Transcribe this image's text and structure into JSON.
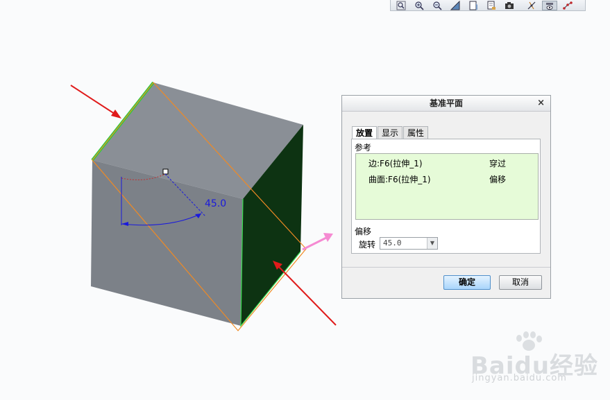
{
  "toolbar": {
    "buttons": [
      {
        "icon": "zoom-fit-icon"
      },
      {
        "icon": "zoom-in-icon"
      },
      {
        "icon": "zoom-out-icon"
      },
      {
        "icon": "repaint-icon"
      },
      {
        "icon": "saved-views-icon"
      },
      {
        "icon": "layers-icon"
      },
      {
        "icon": "camera-icon"
      },
      {
        "icon": "datum-display-icon"
      },
      {
        "icon": "show-planes-icon",
        "active": true
      },
      {
        "icon": "spin-center-icon"
      }
    ]
  },
  "model": {
    "dimension_value": "45.0",
    "colors": {
      "top_face": "#8a8f96",
      "front_face": "#7c8188",
      "side_face": "#0d3312",
      "edge_highlight": "#2ecc40",
      "datum_plane": "#f08a24",
      "dimension": "#1a1adc",
      "arrow_red": "#e01b1b",
      "arrow_pink": "#f58ad2"
    }
  },
  "dialog": {
    "title": "基准平面",
    "close_symbol": "×",
    "tabs": [
      {
        "label": "放置",
        "active": true
      },
      {
        "label": "显示",
        "active": false
      },
      {
        "label": "属性",
        "active": false
      }
    ],
    "references": {
      "heading": "参考",
      "rows": [
        {
          "name": "边:F6(拉伸_1)",
          "type": "穿过"
        },
        {
          "name": "曲面:F6(拉伸_1)",
          "type": "偏移"
        }
      ],
      "list_color": "#e6fbd8"
    },
    "offset": {
      "heading": "偏移",
      "rotation_label": "旋转",
      "rotation_value": "45.0",
      "dropdown_symbol": "▼"
    },
    "ok_label": "确定",
    "cancel_label": "取消"
  },
  "watermark": {
    "brand": "Baidu经验",
    "url": "jingyan.baidu.com"
  }
}
